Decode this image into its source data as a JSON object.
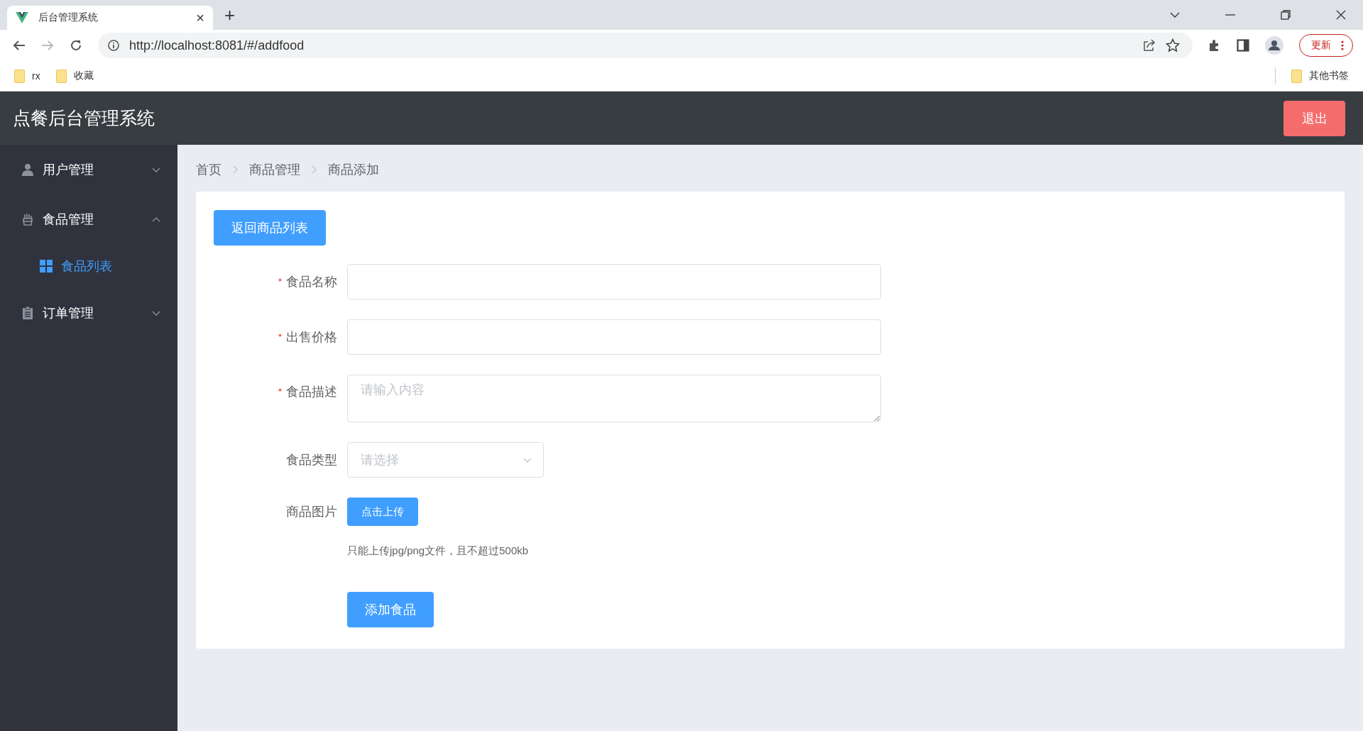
{
  "browser": {
    "tab": {
      "title": "后台管理系统",
      "close": "×"
    },
    "new_tab": "+",
    "url": "http://localhost:8081/#/addfood",
    "update_button": "更新",
    "bookmarks": [
      "rx",
      "收藏"
    ],
    "other_bookmarks": "其他书签"
  },
  "header": {
    "title": "点餐后台管理系统",
    "logout": "退出"
  },
  "sidebar": {
    "items": [
      {
        "label": "用户管理",
        "kind": "user",
        "expanded": false
      },
      {
        "label": "食品管理",
        "kind": "food",
        "expanded": true,
        "children": [
          {
            "label": "食品列表",
            "selected": true
          }
        ]
      },
      {
        "label": "订单管理",
        "kind": "order",
        "expanded": false
      }
    ]
  },
  "breadcrumb": [
    "首页",
    "商品管理",
    "商品添加"
  ],
  "back_button": "返回商品列表",
  "form": {
    "fields": [
      {
        "kind": "input",
        "label": "食品名称",
        "required": true
      },
      {
        "kind": "textinput",
        "label": "出售价格",
        "required": true
      },
      {
        "kind": "textarea",
        "label": "食品描述",
        "required": true,
        "placeholder": "请输入内容"
      },
      {
        "kind": "select",
        "label": "食品类型",
        "required": false,
        "placeholder": "请选择"
      },
      {
        "kind": "upload",
        "label": "商品图片",
        "required": false,
        "button": "点击上传",
        "hint": "只能上传jpg/png文件，且不超过500kb"
      }
    ],
    "submit": "添加食品"
  }
}
